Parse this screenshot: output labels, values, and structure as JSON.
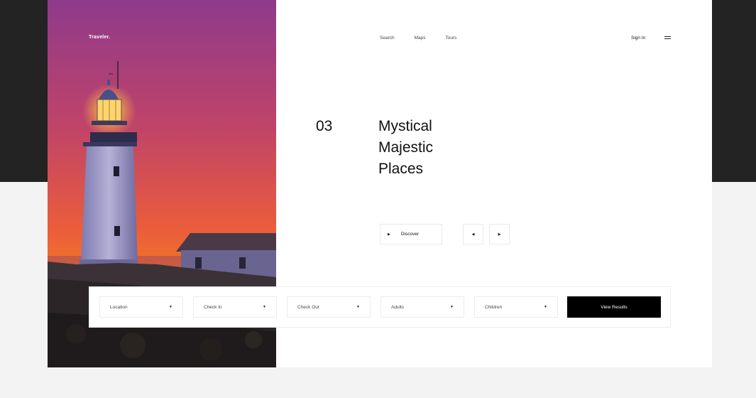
{
  "brand": {
    "logo": "Traveler."
  },
  "nav": {
    "items": [
      "Search",
      "Maps",
      "Tours"
    ],
    "sign_in": "Sign In"
  },
  "hero": {
    "slide_number": "03",
    "title_lines": [
      "Mystical",
      "Majestic",
      "Places"
    ],
    "discover_label": "Discover"
  },
  "search": {
    "fields": [
      "Location",
      "Check In",
      "Check Out",
      "Adults",
      "Children"
    ],
    "submit_label": "View Results"
  },
  "colors": {
    "accent": "#000000",
    "sky_top": "#8e3a8c",
    "sky_bottom": "#f07a24",
    "dark_band": "#232323"
  },
  "icons": {
    "menu": "hamburger-icon",
    "prev": "triangle-left-icon",
    "next": "triangle-right-icon",
    "dropdown": "triangle-down-icon"
  }
}
